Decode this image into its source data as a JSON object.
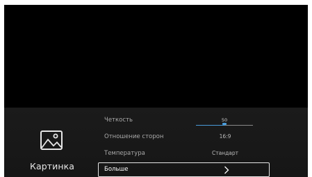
{
  "category": {
    "label": "Картинка",
    "icon": "picture-icon"
  },
  "settings": [
    {
      "label": "Четкость",
      "type": "slider",
      "value": "50",
      "level": 0.5
    },
    {
      "label": "Отношение сторон",
      "type": "value",
      "value": "16:9"
    },
    {
      "label": "Температура",
      "type": "value",
      "value": "Стандарт"
    },
    {
      "label": "Больше",
      "type": "link",
      "icon": "chevron-right-icon"
    }
  ],
  "colors": {
    "accent": "#4a9bd9",
    "background": "#000000",
    "panel": "#1a1a1a"
  }
}
